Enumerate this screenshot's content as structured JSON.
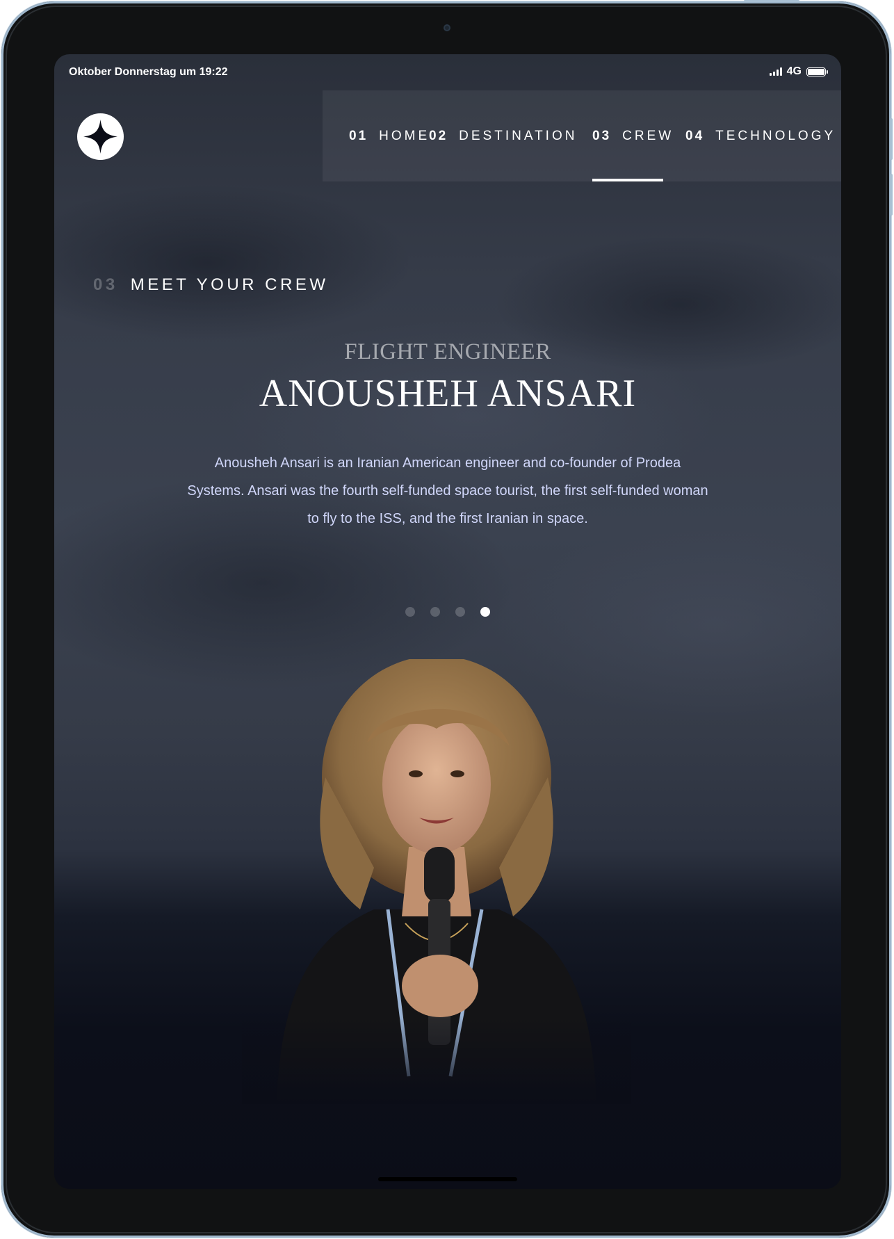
{
  "status_bar": {
    "datetime": "Oktober Donnerstag um 19:22",
    "network": "4G"
  },
  "nav": {
    "items": [
      {
        "num": "01",
        "label": "HOME"
      },
      {
        "num": "02",
        "label": "DESTINATION"
      },
      {
        "num": "03",
        "label": "CREW",
        "active": true
      },
      {
        "num": "04",
        "label": "TECHNOLOGY"
      }
    ]
  },
  "page": {
    "section_number": "03",
    "section_title": "MEET YOUR CREW",
    "role": "FLIGHT ENGINEER",
    "name": "ANOUSHEH ANSARI",
    "bio": "Anousheh Ansari is an Iranian American engineer and co-founder of Prodea Systems. Ansari was the fourth self-funded space tourist, the first self-funded woman to fly to the ISS, and the first Iranian in space.",
    "slides_total": 4,
    "slide_active": 4
  },
  "colors": {
    "background_dark": "#0b0d17",
    "text_light": "#d0d6f9",
    "white": "#ffffff"
  },
  "icons": {
    "logo": "four-point-star-logo-icon"
  }
}
